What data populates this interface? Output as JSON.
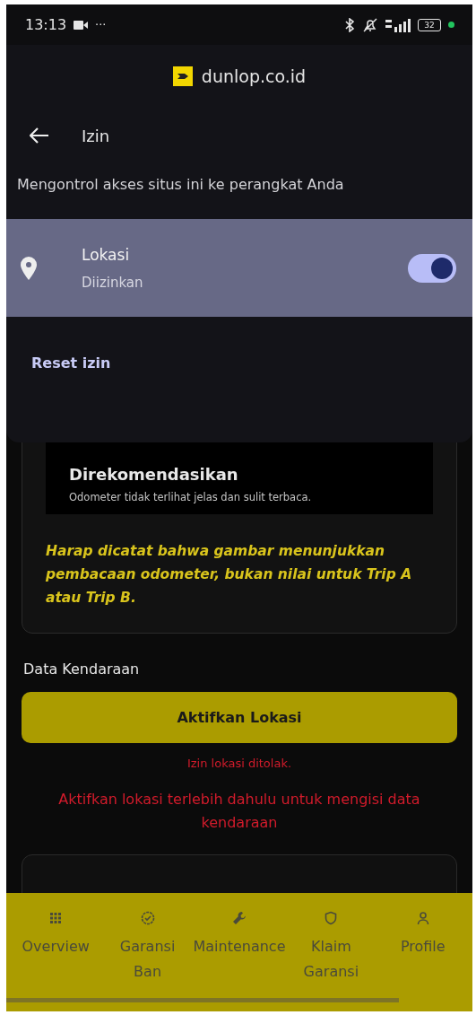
{
  "status_bar": {
    "time": "13:13",
    "more": "···",
    "battery": "32"
  },
  "permission_sheet": {
    "site": "dunlop.co.id",
    "title": "Izin",
    "description": "Mengontrol akses situs ini ke perangkat Anda",
    "permissions": [
      {
        "name": "Lokasi",
        "status": "Diizinkan",
        "on": true
      }
    ],
    "reset": "Reset izin"
  },
  "odometer_card": {
    "title": "Direkomendasikan",
    "caption": "Odometer tidak terlihat jelas dan sulit terbaca.",
    "note": "Harap dicatat bahwa gambar menunjukkan pembacaan odometer, bukan nilai untuk Trip A atau Trip B."
  },
  "vehicle_section": {
    "heading": "Data Kendaraan",
    "button": "Aktifkan Lokasi",
    "error": "Izin lokasi ditolak.",
    "message": "Aktifkan lokasi terlebih dahulu untuk mengisi data kendaraan"
  },
  "bottom_nav": [
    {
      "label": "Overview"
    },
    {
      "label": "Garansi Ban"
    },
    {
      "label": "Maintenance"
    },
    {
      "label": "Klaim Garansi"
    },
    {
      "label": "Profile"
    }
  ]
}
